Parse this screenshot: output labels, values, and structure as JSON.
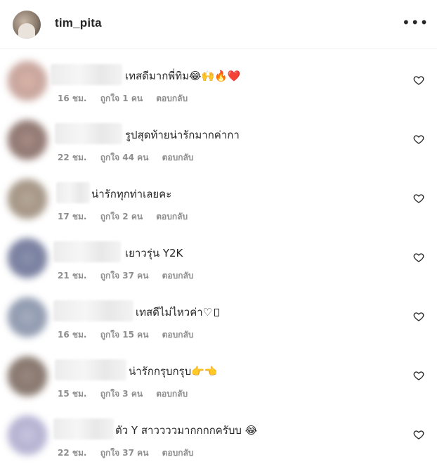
{
  "header": {
    "username": "tim_pita",
    "more_label": "•••"
  },
  "comments": [
    {
      "text": "เทสดีมากพี่ทิม",
      "emojis": "😂🙌🔥❤️",
      "time": "16 ชม.",
      "likes": "ถูกใจ 1 คน",
      "reply": "ตอบกลับ",
      "avatar_color": "#d9b4a8"
    },
    {
      "text": "รูปสุดท้ายน่ารักมากค่ากา",
      "emojis": "",
      "time": "22 ชม.",
      "likes": "ถูกใจ 44 คน",
      "reply": "ตอบกลับ",
      "avatar_color": "#a98e86"
    },
    {
      "text": "น่ารักทุกท่าเลยคะ",
      "emojis": "",
      "time": "17 ชม.",
      "likes": "ถูกใจ 2 คน",
      "reply": "ตอบกลับ",
      "avatar_color": "#b7a99a"
    },
    {
      "text": "เยาวรุ่น Y2K",
      "emojis": "",
      "time": "21 ชม.",
      "likes": "ถูกใจ 37 คน",
      "reply": "ตอบกลับ",
      "avatar_color": "#8c93b0"
    },
    {
      "text": "เทสดีไม่ไหวค่า",
      "emojis": "♡",
      "time": "16 ชม.",
      "likes": "ถูกใจ 15 คน",
      "reply": "ตอบกลับ",
      "avatar_color": "#a7b0c2"
    },
    {
      "text": "น่ารักกรุบกรุบ",
      "emojis": "👉👈",
      "time": "15 ชม.",
      "likes": "ถูกใจ 3 คน",
      "reply": "ตอบกลับ",
      "avatar_color": "#9c8a80"
    },
    {
      "text": "ตัว Y สาววววมากกกกครับบ",
      "emojis": "😂",
      "time": "22 ชม.",
      "likes": "ถูกใจ 37 คน",
      "reply": "ตอบกลับ",
      "avatar_color": "#c9c7e0"
    }
  ]
}
